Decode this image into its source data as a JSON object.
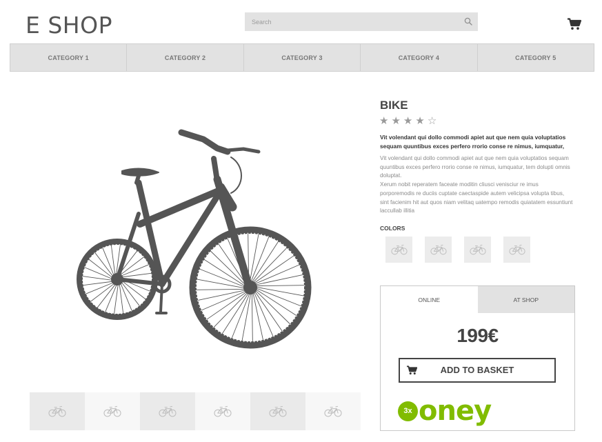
{
  "header": {
    "logo": "E SHOP",
    "search_placeholder": "Search",
    "icons": {
      "search": "search-icon",
      "cart": "cart-icon"
    }
  },
  "nav": {
    "categories": [
      "CATEGORY 1",
      "CATEGORY 2",
      "CATEGORY 3",
      "CATEGORY 4",
      "CATEGORY 5"
    ]
  },
  "gallery": {
    "main_image": "bike-silhouette",
    "thumbnail_count": 6,
    "thumbnail_icon": "bike-icon"
  },
  "product": {
    "title": "BIKE",
    "rating": {
      "value": 4,
      "max": 5,
      "filled": "★",
      "empty": "☆"
    },
    "lead": "Vit volendant qui dollo commodi apiet aut que nem quia voluptatios sequam quuntibus exces perfero rrorio conse re nimus, iumquatur,",
    "description_1": "Vit volendant qui dollo commodi apiet aut que nem quia voluptatios sequam quuntibus exces perfero rrorio conse re nimus, iumquatur, tem dolupti omnis doluptat.",
    "description_2": "Xerum nobit reperatem faceate moditin cliusci venisciur re imus porporemodis re duciis cuptate caectaspide autem velicipsa volupta tibus, sint facienim hit aut quos niam velitaq uatempo remodis quiatatem essuntiunt laccullab illitia",
    "colors_label": "COLORS",
    "color_swatch_count": 4
  },
  "buybox": {
    "tabs": [
      "ONLINE",
      "AT SHOP"
    ],
    "active_tab": "ONLINE",
    "price": "199€",
    "add_to_basket": "ADD TO BASKET",
    "financing": {
      "badge": "3x",
      "brand": "oney",
      "color": "#81bc00"
    }
  },
  "colors": {
    "accent_gray": "#444444",
    "panel_gray": "#e2e2e2",
    "oney_green": "#81bc00"
  }
}
